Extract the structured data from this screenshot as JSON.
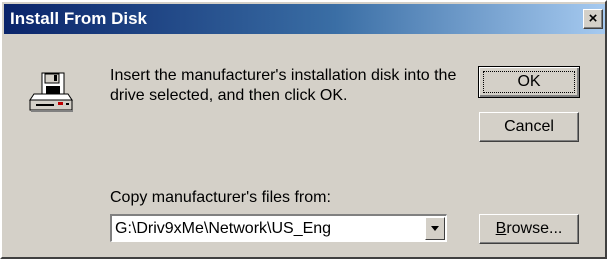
{
  "window": {
    "title": "Install From Disk",
    "close_label": "×"
  },
  "icon": "floppy-disk-drive-icon",
  "message": "Insert the manufacturer's installation disk into the drive selected, and then click OK.",
  "buttons": {
    "ok": "OK",
    "cancel": "Cancel",
    "browse_accel": "B",
    "browse_rest": "rowse..."
  },
  "copy_from": {
    "label": "Copy manufacturer's files from:",
    "value": "G:\\Driv9xMe\\Network\\US_Eng"
  },
  "colors": {
    "face": "#d4d0c8",
    "title_start": "#0a246a",
    "title_end": "#a6caf0"
  }
}
